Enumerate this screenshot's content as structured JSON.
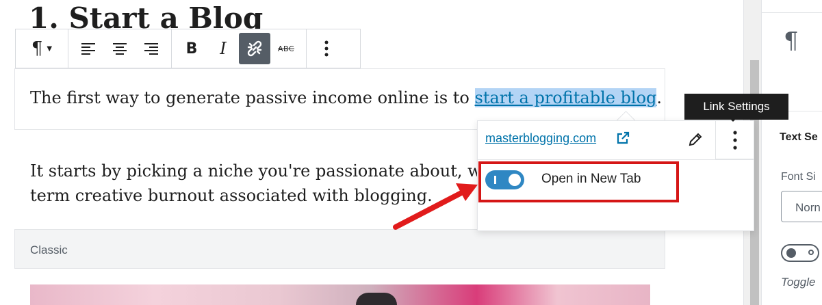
{
  "heading": "1. Start a Blog",
  "toolbar": {
    "paragraph_icon": "¶",
    "caret": "▼",
    "align_left_icon": "align-left-icon",
    "align_center_icon": "align-center-icon",
    "align_right_icon": "align-right-icon",
    "bold": "B",
    "italic": "I",
    "link_icon": "link-icon",
    "strikethrough": "ABC",
    "more": "⋮"
  },
  "content": {
    "p1_before": "The first way to generate passive income online is to ",
    "p1_link": "start a profitable blog",
    "p1_after": ".",
    "p2_line1": "It starts by picking a niche you're passionate about, wh",
    "p2_line2": "term creative burnout associated with blogging."
  },
  "classic_block": {
    "label": "Classic"
  },
  "link_popover": {
    "url": "masterblogging.com",
    "tooltip": "Link Settings",
    "toggle_label": "Open in New Tab",
    "toggle_on": true
  },
  "sidebar": {
    "paragraph_icon": "¶",
    "section_title": "Text Se",
    "font_size_label": "Font Si",
    "select_value": "Norn",
    "toggle_caption": "Toggle"
  },
  "colors": {
    "link": "#0073aa",
    "toggle_on": "#2f87c3",
    "highlight_box": "#d51616",
    "tooltip_bg": "#1e1e1e"
  }
}
